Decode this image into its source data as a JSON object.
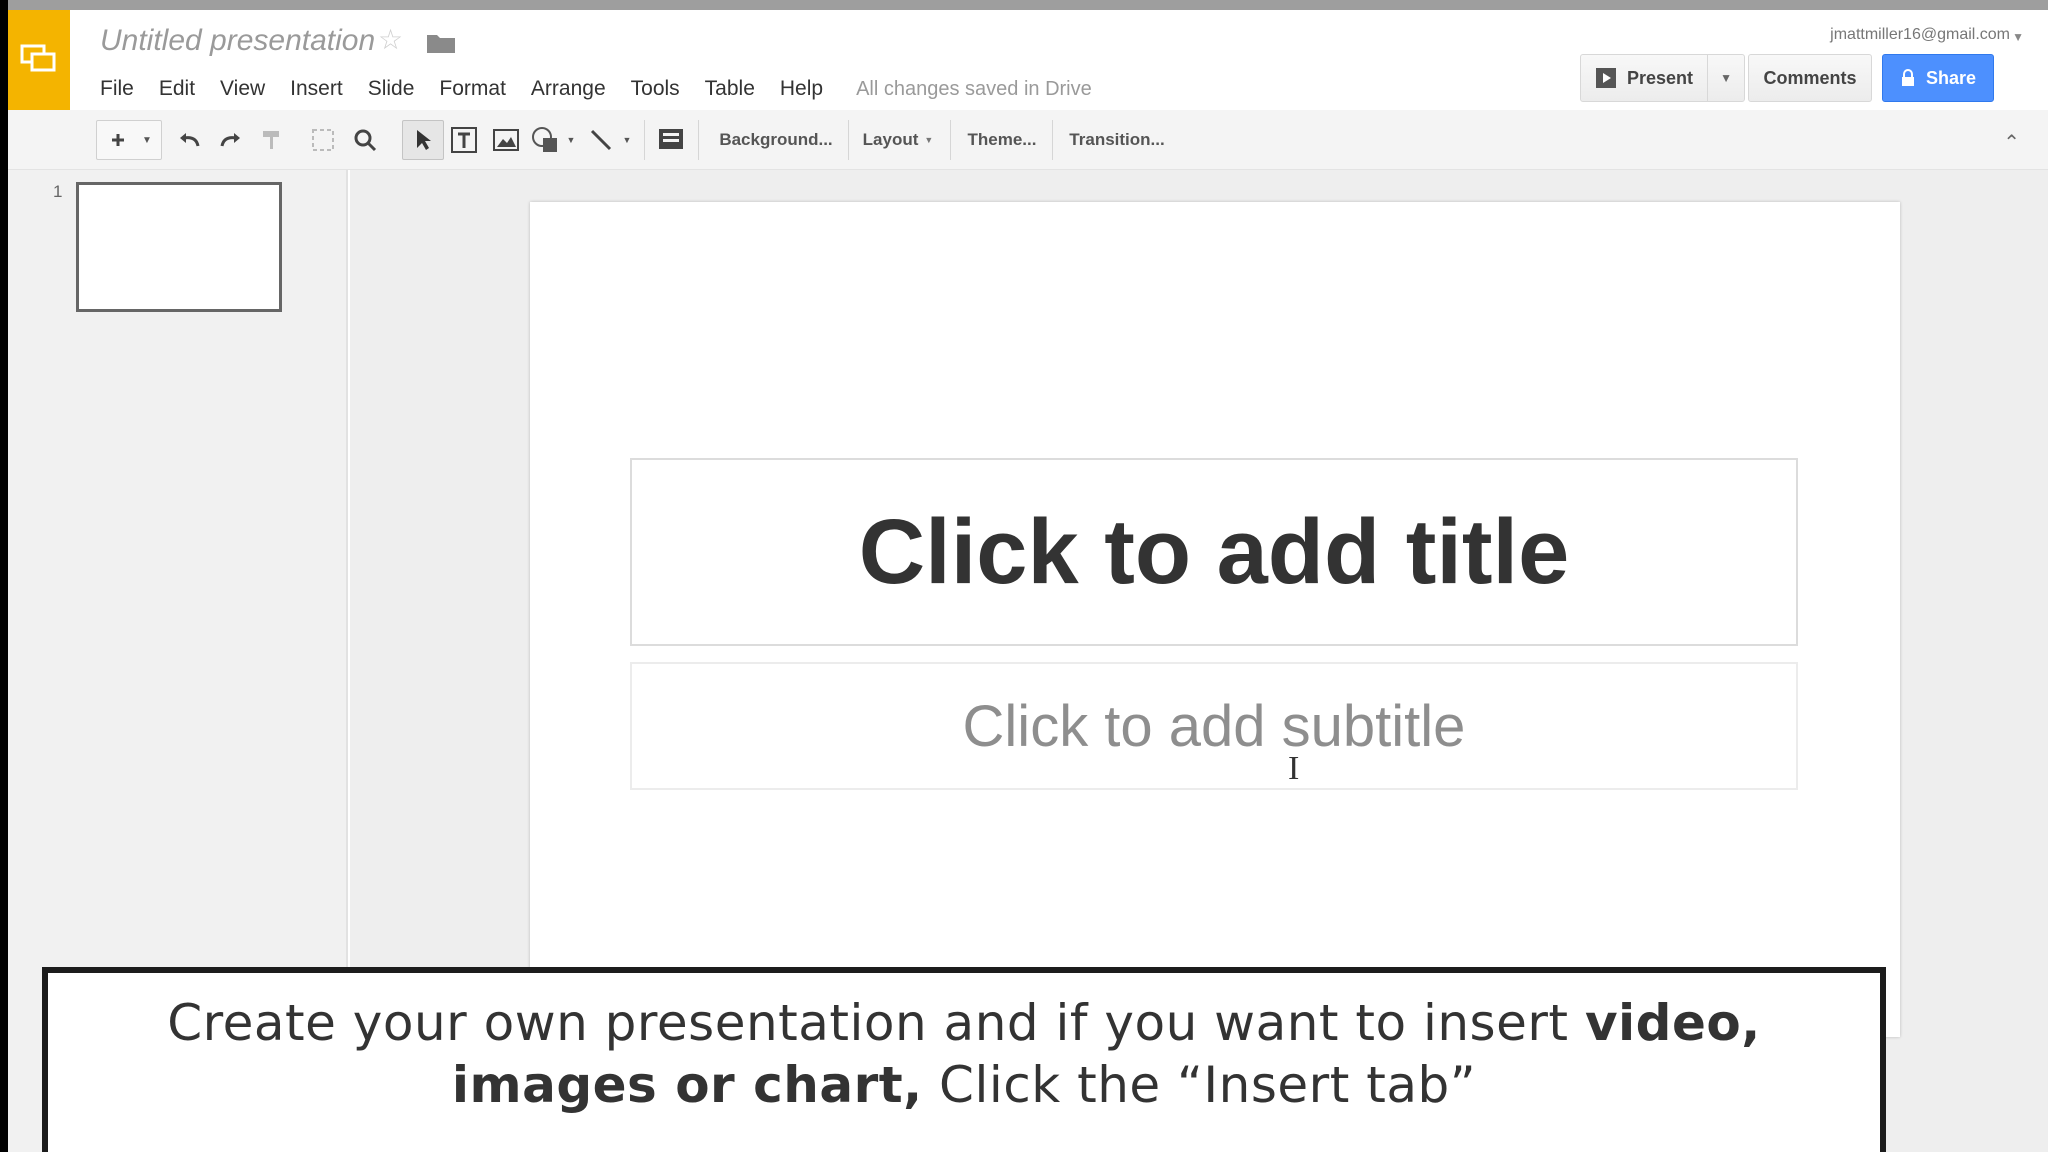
{
  "header": {
    "doc_title": "Untitled presentation",
    "account": "jmattmiller16@gmail.com",
    "present_label": "Present",
    "comments_label": "Comments",
    "share_label": "Share",
    "brand_color": "#f4b400",
    "share_color": "#4d90fe"
  },
  "menu": {
    "items": [
      "File",
      "Edit",
      "View",
      "Insert",
      "Slide",
      "Format",
      "Arrange",
      "Tools",
      "Table",
      "Help"
    ],
    "save_status": "All changes saved in Drive"
  },
  "toolbar": {
    "background_label": "Background...",
    "layout_label": "Layout",
    "theme_label": "Theme...",
    "transition_label": "Transition..."
  },
  "filmstrip": {
    "slide_number": "1"
  },
  "slide": {
    "title_placeholder": "Click to add title",
    "subtitle_placeholder": "Click to add subtitle"
  },
  "caption": {
    "part1": "Create your own presentation and if you want to insert ",
    "bold1": "video, images or chart,",
    "part2": " Click the “Insert tab”"
  }
}
